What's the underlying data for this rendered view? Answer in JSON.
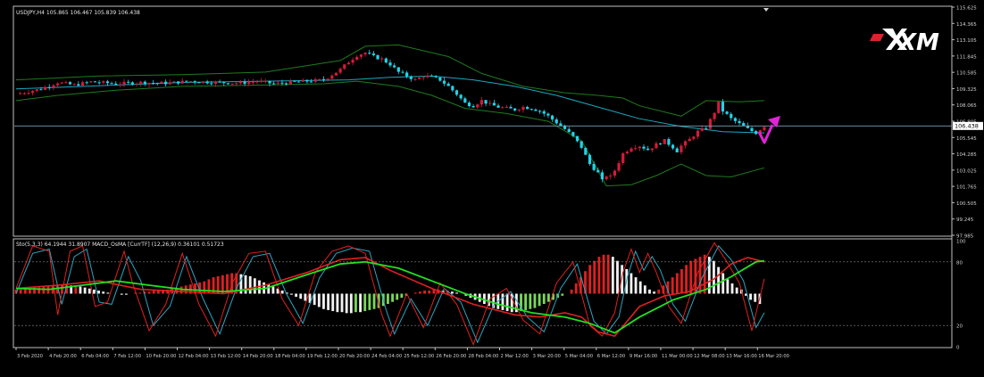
{
  "main_header": "USDJPY,H4  105.865 106.467 105.839 106.438",
  "sub_header": "Sto(5,3,3) 64.1944 31.8907   MACD_OsMA [CurrTF] (12,26,9) 0.36101 0.51723",
  "logo_text": "XM",
  "current_price_label": "106.438",
  "colors": {
    "background": "#000000",
    "frame": "#c0c0c0",
    "axis_text": "#d0d0d0",
    "bull": "#d41a3c",
    "bear": "#22d3e8",
    "bb_outer": "#1f7a1f",
    "ma_cyan": "#1aa8c0",
    "price_line": "#7aa0b8",
    "sto_main": "#e02020",
    "sto_signal": "#2aa6c4",
    "slow_line": "#22e022",
    "osma_pos_up": "#e02020",
    "osma_pos_down": "#f2f2f2",
    "osma_neg_down": "#f2f2f2",
    "osma_neg_up": "#7ad85a",
    "arrow": "#e023d6"
  },
  "chart_data": [
    {
      "type": "candlestick",
      "symbol": "USDJPY",
      "timeframe": "H4",
      "ohlc_current": {
        "open": 105.865,
        "high": 106.467,
        "low": 105.839,
        "close": 106.438
      },
      "y_ticks": [
        "115.625",
        "114.365",
        "113.105",
        "111.845",
        "110.585",
        "109.325",
        "108.065",
        "106.805",
        "105.545",
        "104.285",
        "103.025",
        "101.765",
        "100.505",
        "99.245",
        "97.985"
      ],
      "ylim": [
        97.985,
        115.625
      ],
      "current_price": 106.438,
      "x_tick_labels": [
        "3 Feb 2020",
        "4 Feb 20:00",
        "6 Feb 04:00",
        "7 Feb 12:00",
        "10 Feb 20:00",
        "12 Feb 04:00",
        "13 Feb 12:00",
        "14 Feb 20:00",
        "18 Feb 04:00",
        "19 Feb 12:00",
        "20 Feb 20:00",
        "24 Feb 04:00",
        "25 Feb 12:00",
        "26 Feb 20:00",
        "28 Feb 04:00",
        "2 Mar 12:00",
        "3 Mar 20:00",
        "5 Mar 04:00",
        "6 Mar 12:00",
        "9 Mar 16:00",
        "11 Mar 00:00",
        "12 Mar 08:00",
        "13 Mar 16:00",
        "16 Mar 20:00"
      ],
      "close_path": [
        [
          0,
          108.9
        ],
        [
          6,
          109.3
        ],
        [
          10,
          109.8
        ],
        [
          14,
          109.6
        ],
        [
          18,
          109.85
        ],
        [
          24,
          109.7
        ],
        [
          30,
          109.8
        ],
        [
          36,
          109.75
        ],
        [
          42,
          109.9
        ],
        [
          48,
          109.8
        ],
        [
          54,
          109.75
        ],
        [
          58,
          109.9
        ],
        [
          62,
          109.7
        ],
        [
          66,
          109.8
        ],
        [
          70,
          109.9
        ],
        [
          74,
          110.0
        ],
        [
          78,
          110.8
        ],
        [
          80,
          111.4
        ],
        [
          82,
          111.9
        ],
        [
          84,
          112.1
        ],
        [
          86,
          111.8
        ],
        [
          88,
          111.6
        ],
        [
          90,
          111.2
        ],
        [
          92,
          110.6
        ],
        [
          94,
          110.3
        ],
        [
          96,
          110.0
        ],
        [
          98,
          110.3
        ],
        [
          100,
          110.2
        ],
        [
          102,
          110.0
        ],
        [
          104,
          109.5
        ],
        [
          106,
          108.9
        ],
        [
          108,
          108.2
        ],
        [
          110,
          108.0
        ],
        [
          112,
          108.4
        ],
        [
          114,
          108.1
        ],
        [
          116,
          107.9
        ],
        [
          118,
          107.8
        ],
        [
          120,
          107.7
        ],
        [
          122,
          107.9
        ],
        [
          124,
          107.8
        ],
        [
          126,
          107.6
        ],
        [
          128,
          107.2
        ],
        [
          130,
          106.7
        ],
        [
          132,
          106.2
        ],
        [
          134,
          105.6
        ],
        [
          136,
          104.8
        ],
        [
          138,
          103.5
        ],
        [
          140,
          102.8
        ],
        [
          141,
          102.2
        ],
        [
          142,
          102.6
        ],
        [
          143,
          102.5
        ],
        [
          144,
          103.0
        ],
        [
          146,
          104.3
        ],
        [
          148,
          104.8
        ],
        [
          150,
          104.9
        ],
        [
          152,
          104.6
        ],
        [
          154,
          105.0
        ],
        [
          156,
          105.3
        ],
        [
          158,
          104.8
        ],
        [
          159,
          104.5
        ],
        [
          160,
          104.9
        ],
        [
          162,
          105.4
        ],
        [
          164,
          106.0
        ],
        [
          166,
          106.3
        ],
        [
          168,
          107.5
        ],
        [
          169,
          108.2
        ],
        [
          170,
          107.6
        ],
        [
          172,
          107.0
        ],
        [
          174,
          106.6
        ],
        [
          176,
          106.2
        ],
        [
          178,
          105.9
        ],
        [
          180,
          106.44
        ]
      ],
      "ma_path": [
        [
          0,
          109.3
        ],
        [
          20,
          109.55
        ],
        [
          40,
          109.8
        ],
        [
          60,
          109.9
        ],
        [
          80,
          110.0
        ],
        [
          90,
          110.2
        ],
        [
          100,
          110.3
        ],
        [
          110,
          110.0
        ],
        [
          120,
          109.5
        ],
        [
          130,
          108.8
        ],
        [
          140,
          107.9
        ],
        [
          150,
          107.0
        ],
        [
          160,
          106.4
        ],
        [
          170,
          106.0
        ],
        [
          180,
          105.9
        ]
      ],
      "bb_upper_path": [
        [
          0,
          110.0
        ],
        [
          20,
          110.3
        ],
        [
          40,
          110.4
        ],
        [
          60,
          110.6
        ],
        [
          78,
          111.5
        ],
        [
          84,
          112.6
        ],
        [
          92,
          112.7
        ],
        [
          104,
          111.8
        ],
        [
          112,
          110.5
        ],
        [
          122,
          109.5
        ],
        [
          132,
          109.0
        ],
        [
          140,
          108.8
        ],
        [
          146,
          108.6
        ],
        [
          150,
          108.0
        ],
        [
          160,
          107.2
        ],
        [
          166,
          108.4
        ],
        [
          174,
          108.3
        ],
        [
          180,
          108.4
        ]
      ],
      "bb_lower_path": [
        [
          0,
          108.4
        ],
        [
          10,
          108.8
        ],
        [
          24,
          109.2
        ],
        [
          40,
          109.5
        ],
        [
          60,
          109.6
        ],
        [
          74,
          109.7
        ],
        [
          82,
          109.9
        ],
        [
          92,
          109.5
        ],
        [
          100,
          108.8
        ],
        [
          108,
          107.8
        ],
        [
          118,
          107.4
        ],
        [
          128,
          106.8
        ],
        [
          136,
          105.3
        ],
        [
          142,
          101.8
        ],
        [
          148,
          101.9
        ],
        [
          154,
          102.6
        ],
        [
          160,
          103.5
        ],
        [
          166,
          102.6
        ],
        [
          172,
          102.5
        ],
        [
          180,
          103.2
        ]
      ]
    },
    {
      "type": "line",
      "name": "Sto(5,3,3) + MACD_OsMA [CurrTF] (12,26,9)",
      "values_printed": {
        "sto_main": 64.1944,
        "sto_signal": 31.8907,
        "osma": 0.36101,
        "osma_signal": 0.51723
      },
      "y_ticks": [
        100,
        80,
        20,
        0
      ],
      "levels": [
        80,
        20
      ],
      "ylim": [
        0,
        100
      ],
      "sto_main_path": [
        [
          0,
          55
        ],
        [
          4,
          95
        ],
        [
          8,
          90
        ],
        [
          10,
          30
        ],
        [
          13,
          90
        ],
        [
          16,
          95
        ],
        [
          19,
          38
        ],
        [
          22,
          42
        ],
        [
          26,
          90
        ],
        [
          28,
          60
        ],
        [
          32,
          15
        ],
        [
          36,
          40
        ],
        [
          40,
          88
        ],
        [
          44,
          40
        ],
        [
          48,
          10
        ],
        [
          52,
          60
        ],
        [
          56,
          88
        ],
        [
          60,
          90
        ],
        [
          64,
          45
        ],
        [
          68,
          20
        ],
        [
          72,
          70
        ],
        [
          76,
          90
        ],
        [
          80,
          95
        ],
        [
          84,
          88
        ],
        [
          88,
          30
        ],
        [
          90,
          10
        ],
        [
          94,
          50
        ],
        [
          98,
          18
        ],
        [
          102,
          60
        ],
        [
          106,
          40
        ],
        [
          110,
          2
        ],
        [
          114,
          45
        ],
        [
          118,
          55
        ],
        [
          122,
          25
        ],
        [
          126,
          12
        ],
        [
          130,
          60
        ],
        [
          134,
          80
        ],
        [
          138,
          20
        ],
        [
          141,
          10
        ],
        [
          144,
          32
        ],
        [
          146,
          70
        ],
        [
          148,
          92
        ],
        [
          150,
          70
        ],
        [
          152,
          88
        ],
        [
          154,
          70
        ],
        [
          157,
          38
        ],
        [
          160,
          22
        ],
        [
          164,
          70
        ],
        [
          168,
          98
        ],
        [
          171,
          80
        ],
        [
          174,
          60
        ],
        [
          177,
          15
        ],
        [
          180,
          64
        ]
      ],
      "sto_signal_path": [
        [
          0,
          50
        ],
        [
          4,
          88
        ],
        [
          8,
          92
        ],
        [
          11,
          40
        ],
        [
          14,
          85
        ],
        [
          17,
          92
        ],
        [
          20,
          42
        ],
        [
          23,
          40
        ],
        [
          27,
          85
        ],
        [
          30,
          62
        ],
        [
          33,
          20
        ],
        [
          37,
          38
        ],
        [
          41,
          85
        ],
        [
          45,
          45
        ],
        [
          49,
          12
        ],
        [
          53,
          55
        ],
        [
          57,
          85
        ],
        [
          61,
          88
        ],
        [
          65,
          50
        ],
        [
          69,
          22
        ],
        [
          73,
          65
        ],
        [
          77,
          88
        ],
        [
          81,
          93
        ],
        [
          85,
          90
        ],
        [
          89,
          35
        ],
        [
          91,
          12
        ],
        [
          95,
          45
        ],
        [
          99,
          20
        ],
        [
          103,
          55
        ],
        [
          107,
          42
        ],
        [
          111,
          4
        ],
        [
          115,
          40
        ],
        [
          119,
          52
        ],
        [
          123,
          28
        ],
        [
          127,
          14
        ],
        [
          131,
          55
        ],
        [
          135,
          78
        ],
        [
          139,
          24
        ],
        [
          142,
          12
        ],
        [
          145,
          28
        ],
        [
          147,
          65
        ],
        [
          149,
          90
        ],
        [
          151,
          72
        ],
        [
          153,
          85
        ],
        [
          155,
          72
        ],
        [
          158,
          40
        ],
        [
          161,
          24
        ],
        [
          165,
          65
        ],
        [
          169,
          95
        ],
        [
          172,
          82
        ],
        [
          175,
          62
        ],
        [
          178,
          18
        ],
        [
          180,
          32
        ]
      ],
      "slow_red_path": [
        [
          0,
          55
        ],
        [
          10,
          58
        ],
        [
          20,
          62
        ],
        [
          30,
          54
        ],
        [
          40,
          52
        ],
        [
          50,
          50
        ],
        [
          60,
          58
        ],
        [
          70,
          70
        ],
        [
          78,
          82
        ],
        [
          84,
          84
        ],
        [
          90,
          72
        ],
        [
          100,
          55
        ],
        [
          110,
          40
        ],
        [
          120,
          30
        ],
        [
          126,
          28
        ],
        [
          132,
          32
        ],
        [
          136,
          28
        ],
        [
          140,
          14
        ],
        [
          144,
          10
        ],
        [
          150,
          38
        ],
        [
          156,
          48
        ],
        [
          162,
          52
        ],
        [
          168,
          64
        ],
        [
          172,
          78
        ],
        [
          176,
          84
        ],
        [
          180,
          80
        ]
      ],
      "slow_green_path": [
        [
          0,
          55
        ],
        [
          8,
          54
        ],
        [
          16,
          58
        ],
        [
          24,
          62
        ],
        [
          32,
          58
        ],
        [
          40,
          54
        ],
        [
          50,
          52
        ],
        [
          60,
          55
        ],
        [
          70,
          68
        ],
        [
          78,
          78
        ],
        [
          84,
          80
        ],
        [
          92,
          74
        ],
        [
          100,
          62
        ],
        [
          108,
          50
        ],
        [
          116,
          40
        ],
        [
          124,
          32
        ],
        [
          132,
          28
        ],
        [
          138,
          22
        ],
        [
          144,
          13
        ],
        [
          150,
          28
        ],
        [
          158,
          44
        ],
        [
          166,
          54
        ],
        [
          172,
          66
        ],
        [
          178,
          80
        ],
        [
          180,
          81
        ]
      ],
      "osma_histogram": [
        4,
        4,
        5,
        5,
        6,
        6,
        7,
        7,
        8,
        8,
        9,
        9,
        8,
        8,
        7,
        6,
        5,
        4,
        3,
        2,
        1,
        0,
        0,
        -1,
        -1,
        0,
        1,
        1,
        2,
        2,
        3,
        3,
        4,
        4,
        5,
        6,
        7,
        8,
        9,
        10,
        11,
        12,
        14,
        16,
        17,
        18,
        19,
        20,
        20,
        19,
        18,
        17,
        15,
        13,
        11,
        9,
        7,
        5,
        3,
        1,
        -1,
        -3,
        -5,
        -7,
        -9,
        -11,
        -13,
        -15,
        -16,
        -17,
        -18,
        -18,
        -19,
        -19,
        -18,
        -18,
        -17,
        -16,
        -15,
        -14,
        -12,
        -10,
        -8,
        -6,
        -4,
        -2,
        0,
        1,
        2,
        3,
        3,
        4,
        4,
        3,
        3,
        2,
        1,
        0,
        -2,
        -4,
        -6,
        -8,
        -10,
        -12,
        -14,
        -15,
        -16,
        -17,
        -18,
        -18,
        -17,
        -16,
        -15,
        -14,
        -12,
        -10,
        -8,
        -6,
        -4,
        -2,
        0,
        4,
        10,
        16,
        22,
        28,
        32,
        36,
        38,
        38,
        36,
        32,
        28,
        24,
        20,
        16,
        12,
        8,
        4,
        2,
        4,
        8,
        12,
        16,
        20,
        24,
        28,
        32,
        34,
        36,
        38,
        36,
        32,
        26,
        20,
        14,
        10,
        6,
        4,
        -2,
        -6,
        -8,
        -10
      ]
    }
  ]
}
